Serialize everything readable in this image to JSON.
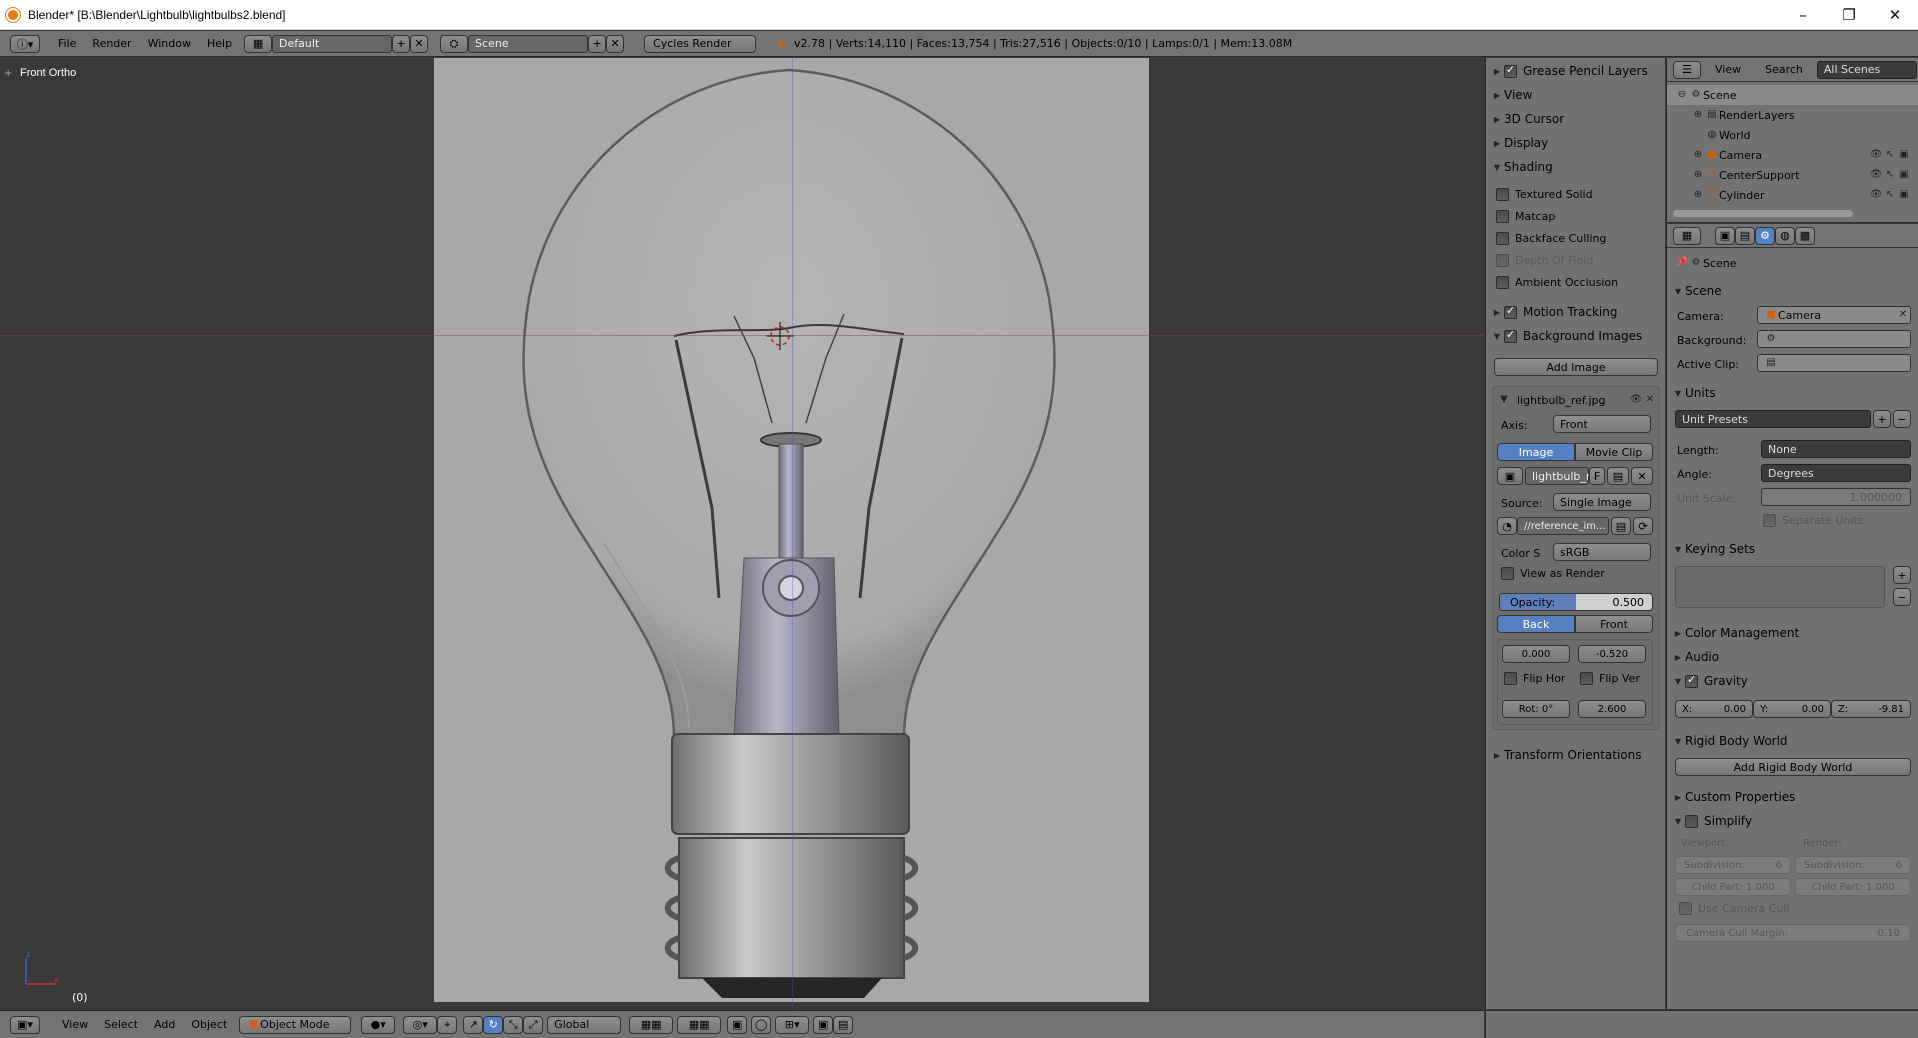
{
  "window": {
    "title": "Blender* [B:\\Blender\\Lightbulb\\lightbulbs2.blend]",
    "min": "–",
    "max": "❐",
    "close": "✕"
  },
  "infobar": {
    "menus": [
      "File",
      "Render",
      "Window",
      "Help"
    ],
    "layout": "Default",
    "scene": "Scene",
    "engine": "Cycles Render",
    "stats": "v2.78 | Verts:14,110 | Faces:13,754 | Tris:27,516 | Objects:0/10 | Lamps:0/1 | Mem:13.08M"
  },
  "viewport": {
    "view_label": "Front Ortho",
    "frame": "(0)"
  },
  "npanel": {
    "panels": {
      "grease_pencil": "Grease Pencil Layers",
      "view": "View",
      "cursor": "3D Cursor",
      "display": "Display",
      "shading": "Shading"
    },
    "shading_opts": [
      "Textured Solid",
      "Matcap",
      "Backface Culling",
      "Depth Of Field",
      "Ambient Occlusion"
    ],
    "motion_tracking": "Motion Tracking",
    "background_images": "Background Images",
    "add_image": "Add Image",
    "image_name": "lightbulb_ref.jpg",
    "axis_label": "Axis:",
    "axis_value": "Front",
    "tab_image": "Image",
    "tab_movie": "Movie Clip",
    "image_field": "lightbulb_r",
    "image_f": "F",
    "source_label": "Source:",
    "source_value": "Single Image",
    "path": "//reference_im...",
    "colorspace_label": "Color S",
    "colorspace_value": "sRGB",
    "view_as_render": "View as Render",
    "opacity_label": "Opacity:",
    "opacity_value": "0.500",
    "opacity_fraction": 0.5,
    "back": "Back",
    "front": "Front",
    "offset_x": "0.000",
    "offset_y": "-0.520",
    "flip_hor": "Flip Hor",
    "flip_ver": "Flip Ver",
    "rot": "Rot: 0°",
    "size": "2.600",
    "transform_orientations": "Transform Orientations"
  },
  "outliner": {
    "menu_view": "View",
    "menu_search": "Search",
    "scenes_dropdown": "All Scenes",
    "items": [
      "Scene",
      "RenderLayers",
      "World",
      "Camera",
      "CenterSupport",
      "Cylinder"
    ]
  },
  "props": {
    "breadcrumb": "Scene",
    "scene_panel": "Scene",
    "camera_label": "Camera:",
    "camera_value": "Camera",
    "background_label": "Background:",
    "active_clip_label": "Active Clip:",
    "units_panel": "Units",
    "unit_presets": "Unit Presets",
    "length_label": "Length:",
    "length_value": "None",
    "angle_label": "Angle:",
    "angle_value": "Degrees",
    "unit_scale_label": "Unit Scale:",
    "unit_scale_value": "1.000000",
    "separate_units": "Separate Units",
    "keying_sets": "Keying Sets",
    "color_management": "Color Management",
    "audio": "Audio",
    "gravity": "Gravity",
    "gx": "X:",
    "gx_val": "0.00",
    "gy": "Y:",
    "gy_val": "0.00",
    "gz": "Z:",
    "gz_val": "-9.81",
    "rigid_body_world": "Rigid Body World",
    "add_rigid_body_world": "Add Rigid Body World",
    "custom_properties": "Custom Properties",
    "simplify": "Simplify",
    "viewport_label": "Viewport:",
    "render_label": "Render:",
    "subdivision_label": "Subdivision:",
    "subdivision_viewport": "6",
    "subdivision_render": "6",
    "child_part_viewport": "Child Part: 1.000",
    "child_part_render": "Child Part: 1.000",
    "use_camera_cull": "Use Camera Cull",
    "camera_cull_margin": "Camera Cull Margin:",
    "camera_cull_margin_value": "0.10"
  },
  "bottombar": {
    "menus": [
      "View",
      "Select",
      "Add",
      "Object"
    ],
    "mode": "Object Mode",
    "orientation": "Global"
  }
}
